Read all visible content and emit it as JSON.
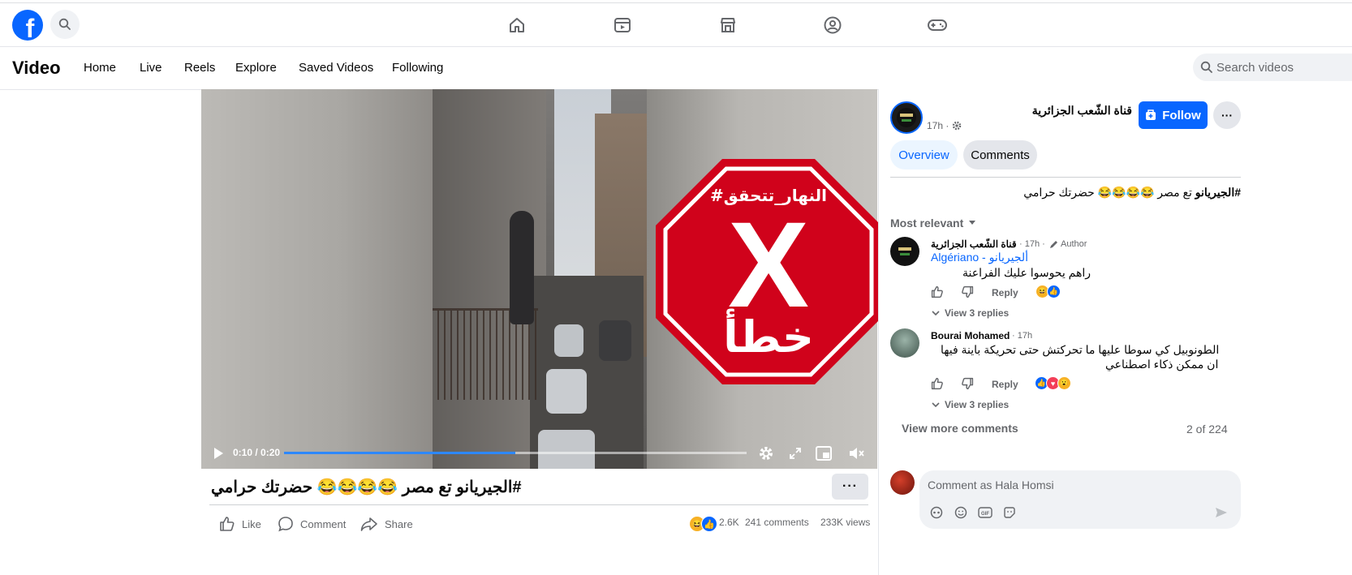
{
  "topbar": {
    "logo_letter": "f",
    "nav_icons": [
      "home-icon",
      "video-icon",
      "marketplace-icon",
      "groups-icon",
      "gaming-icon"
    ]
  },
  "video_nav": {
    "title": "Video",
    "tabs": [
      "Home",
      "Live",
      "Reels",
      "Explore",
      "Saved Videos",
      "Following"
    ],
    "search_placeholder": "Search videos"
  },
  "player": {
    "overlay_hashtag": "#النهار_تتحقق",
    "overlay_mark": "X",
    "overlay_word": "خطأ",
    "time": "0:10 / 0:20",
    "progress": 0.5,
    "sign_color": "#d0021b"
  },
  "post": {
    "title": "#الجيريانو تع مصر 😂😂😂😂 حضرتك حرامي",
    "actions": [
      "Like",
      "Comment",
      "Share"
    ],
    "reaction_count": "2.6K",
    "comments_count": "241 comments",
    "views": "233K views"
  },
  "panel": {
    "page_name": "قناة الشّعب الجزائرية",
    "page_time": "17h ·",
    "follow_label": "Follow",
    "tabs": [
      "Overview",
      "Comments"
    ],
    "caption_bold": "#الجيريانو",
    "caption_rest": " تع مصر 😂😂😂😂 حضرتك حرامي",
    "sort_label": "Most relevant",
    "comments": [
      {
        "author": "قناة الشّعب الجزائرية",
        "time": "· 17h ·",
        "badge": "Author",
        "tag": "Algériano - ألجيريانو",
        "text": "راهم يحوسوا عليك الفراعنة",
        "reply_label": "Reply",
        "view_replies": "View 3 replies"
      },
      {
        "author": "Bourai Mohamed",
        "time": "· 17h",
        "text_line1": "الطونوبيل كي سوطا عليها ما تحركتش حتى تحريكة باينة فيها",
        "text_line2": "ان ممكن ذكاء اصطناعي",
        "reply_label": "Reply",
        "view_replies": "View 3 replies"
      }
    ],
    "view_more": "View more comments",
    "count": "2 of 224",
    "composer_placeholder": "Comment as Hala Homsi"
  },
  "colors": {
    "brand": "#0866ff",
    "panel_bg": "#f0f2f5"
  }
}
